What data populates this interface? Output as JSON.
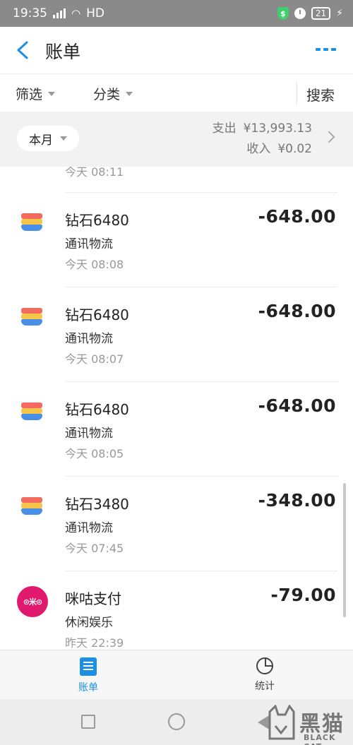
{
  "status_bar": {
    "time": "19:35",
    "network": "HD",
    "battery": "21"
  },
  "header": {
    "title": "账单"
  },
  "filters": {
    "filter_label": "筛选",
    "category_label": "分类",
    "search_label": "搜索"
  },
  "summary": {
    "month_label": "本月",
    "expense_label": "支出",
    "expense_value": "¥13,993.13",
    "income_label": "收入",
    "income_value": "¥0.02"
  },
  "list": {
    "partial_time": "今天  08:11",
    "items": [
      {
        "title": "钻石6480",
        "category": "通讯物流",
        "time": "今天  08:08",
        "amount": "-648.00",
        "icon": "game-stripes-icon"
      },
      {
        "title": "钻石6480",
        "category": "通讯物流",
        "time": "今天  08:07",
        "amount": "-648.00",
        "icon": "game-stripes-icon"
      },
      {
        "title": "钻石6480",
        "category": "通讯物流",
        "time": "今天  08:05",
        "amount": "-648.00",
        "icon": "game-stripes-icon"
      },
      {
        "title": "钻石3480",
        "category": "通讯物流",
        "time": "今天  07:45",
        "amount": "-348.00",
        "icon": "game-stripes-icon"
      },
      {
        "title": "咪咕支付",
        "category": "休闲娱乐",
        "time": "昨天  22:39",
        "amount": "-79.00",
        "icon": "migu-logo-icon"
      }
    ]
  },
  "tabbar": {
    "bill_label": "账单",
    "stats_label": "统计",
    "active_color": "#1a8fe3"
  },
  "watermark": {
    "cn": "黑猫",
    "en": "BLACK CAT"
  },
  "colors": {
    "accent": "#1a8fe3",
    "migu": "#e0186e"
  }
}
